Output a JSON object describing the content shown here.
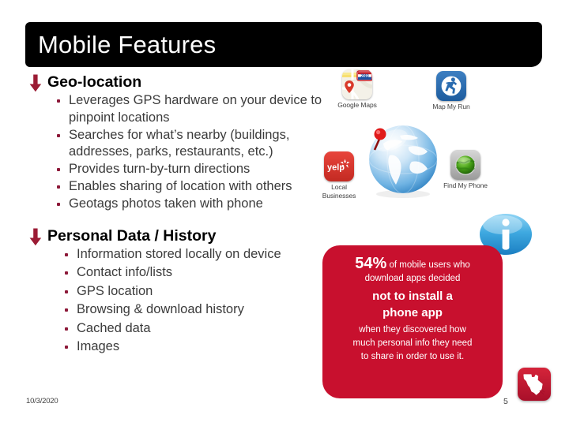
{
  "slide": {
    "title": "Mobile Features",
    "date": "10/3/2020",
    "page_number": "5",
    "accent_red": "#c8102e",
    "bullet_maroon": "#8c1838",
    "title_bar_color": "#000000",
    "body_text_color": "#3b3b3b"
  },
  "sections": [
    {
      "heading": "Geo-location",
      "marker": "down-arrow",
      "bullets": [
        "Leverages GPS hardware on your device to pinpoint locations",
        "Searches for what’s nearby (buildings, addresses, parks, restaurants, etc.)",
        "Provides turn-by-turn directions",
        "Enables sharing of location with others",
        "Geotags photos taken with phone"
      ]
    },
    {
      "heading": "Personal Data / History",
      "marker": "down-arrow",
      "bullets": [
        "Information stored locally on device",
        "Contact info/lists",
        "GPS location",
        "Browsing & download history",
        "Cached data",
        "Images"
      ]
    }
  ],
  "app_icons": [
    {
      "id": "google-maps",
      "label": "Google Maps",
      "icon": "google-maps-icon",
      "shield_number": "280"
    },
    {
      "id": "map-my-run",
      "label": "Map My Run",
      "icon": "running-person-icon"
    },
    {
      "id": "yelp",
      "label": "Local Businesses",
      "icon": "yelp-icon",
      "wordmark": "yelp"
    },
    {
      "id": "find-my-phone",
      "label": "Find My Phone",
      "icon": "find-my-phone-icon"
    }
  ],
  "graphics": {
    "globe": "globe-with-location-pin",
    "info_bubble": "info-speech-bubble-icon",
    "texas_logo": "texas-state-outline-logo"
  },
  "callout": {
    "stat": "54%",
    "line1_rest": " of mobile users who",
    "line2": "download apps decided",
    "emphasis_line1": "not to install a",
    "emphasis_line2": "phone app",
    "line3": "when they discovered how",
    "line4": "much personal info they need",
    "line5": "to share in order to use it."
  }
}
